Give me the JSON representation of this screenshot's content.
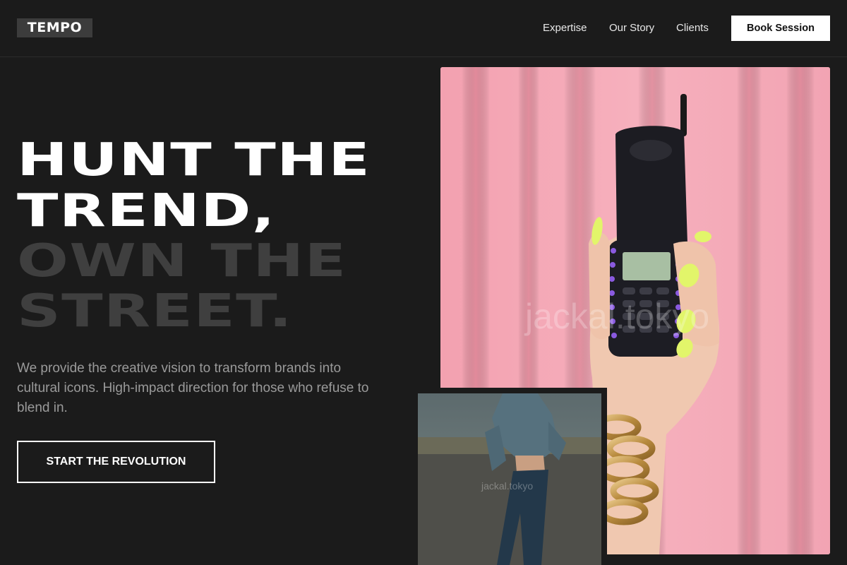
{
  "header": {
    "logo": "TEMPO",
    "nav": {
      "expertise": "Expertise",
      "story": "Our Story",
      "clients": "Clients"
    },
    "cta": "Book Session"
  },
  "hero": {
    "line1": "HUNT THE",
    "line2": "TREND,",
    "line3": "OWN THE",
    "line4": "STREET.",
    "description": "We provide the creative vision to transform brands into cultural icons. High-impact direction for those who refuse to blend in.",
    "cta": "START THE REVOLUTION"
  },
  "images": {
    "main_watermark": "jackal.tokyo",
    "small_watermark": "jackal.tokyo"
  },
  "colors": {
    "background": "#1b1b1b",
    "muted_heading": "#3f3f3f",
    "body_text": "#9a9a9a",
    "accent_pink": "#f4a7b5"
  }
}
